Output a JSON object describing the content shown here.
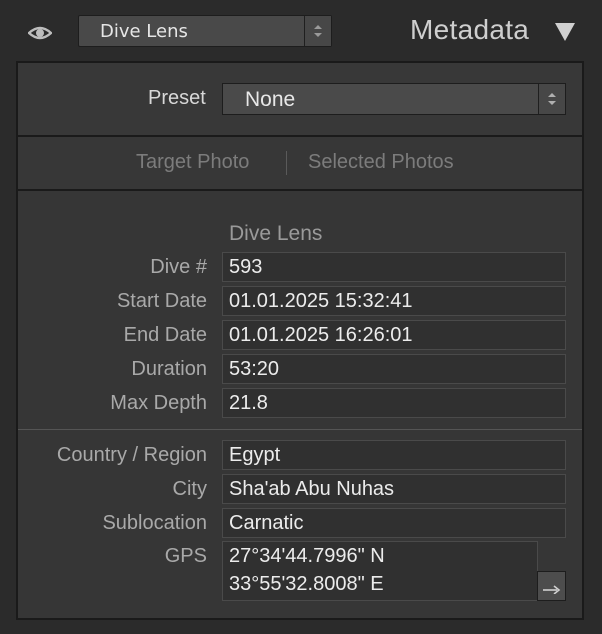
{
  "header": {
    "metadata_set": "Dive Lens",
    "panel_title": "Metadata",
    "icons": {
      "visibility": "eye-icon",
      "collapse": "triangle-down-icon"
    }
  },
  "preset": {
    "label": "Preset",
    "value": "None"
  },
  "tabs": [
    {
      "label": "Target Photo"
    },
    {
      "label": "Selected Photos"
    }
  ],
  "dive_section": {
    "title": "Dive Lens",
    "fields": [
      {
        "label": "Dive #",
        "value": "593"
      },
      {
        "label": "Start Date",
        "value": "01.01.2025 15:32:41"
      },
      {
        "label": "End Date",
        "value": "01.01.2025 16:26:01"
      },
      {
        "label": "Duration",
        "value": "53:20"
      },
      {
        "label": "Max Depth",
        "value": "21.8"
      }
    ]
  },
  "location_section": {
    "fields": [
      {
        "label": "Country / Region",
        "value": "Egypt"
      },
      {
        "label": "City",
        "value": "Sha'ab Abu Nuhas"
      },
      {
        "label": "Sublocation",
        "value": "Carnatic"
      }
    ],
    "gps": {
      "label": "GPS",
      "lat": "27°34'44.7996\" N",
      "lon": "33°55'32.8008\" E"
    }
  }
}
